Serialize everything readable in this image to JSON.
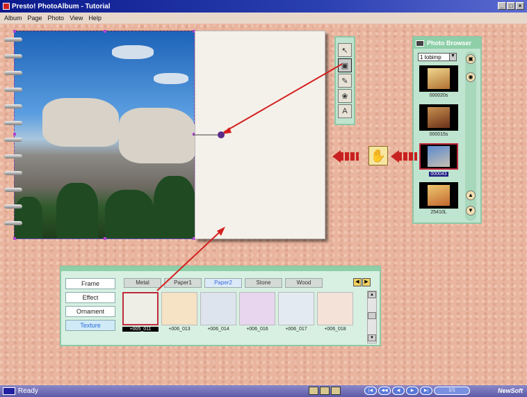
{
  "window": {
    "title": "Presto! PhotoAlbum - Tutorial"
  },
  "menu": [
    "Album",
    "Page",
    "Photo",
    "View",
    "Help"
  ],
  "photo_browser": {
    "title": "Photo Browser",
    "folder": "1 tobimp",
    "items": [
      {
        "label": "000020s",
        "colors": [
          "#f0d890",
          "#b07030"
        ]
      },
      {
        "label": "000015s",
        "colors": [
          "#c89050",
          "#6a3018"
        ]
      },
      {
        "label": "000043",
        "colors": [
          "#5a8ad0",
          "#c8c0b0"
        ],
        "selected": true
      },
      {
        "label": "25410L",
        "colors": [
          "#f0c870",
          "#c06830"
        ]
      }
    ]
  },
  "tools": [
    "arrow-icon",
    "frame-icon",
    "pencil-icon",
    "brush-icon",
    "text-icon"
  ],
  "texture_panel": {
    "categories": [
      "Frame",
      "Effect",
      "Ornament",
      "Texture"
    ],
    "active_category": "Texture",
    "tabs": [
      "Metal",
      "Paper1",
      "Paper2",
      "Stone",
      "Wood"
    ],
    "active_tab": "Paper2",
    "swatches": [
      {
        "label": "+005_011",
        "color": "#eeeee6"
      },
      {
        "label": "+006_013",
        "color": "#f6e2c4"
      },
      {
        "label": "+006_014",
        "color": "#dde4ee"
      },
      {
        "label": "+006_016",
        "color": "#e8d6ee"
      },
      {
        "label": "+006_017",
        "color": "#e4eaf2"
      },
      {
        "label": "+006_018",
        "color": "#f4e2d8"
      }
    ]
  },
  "status": {
    "text": "Ready",
    "page_count": "1/1",
    "brand": "NewSoft"
  },
  "colors": {
    "accent": "#c82020",
    "panel": "#bfe4cf",
    "workspace": "#e9b59e"
  }
}
